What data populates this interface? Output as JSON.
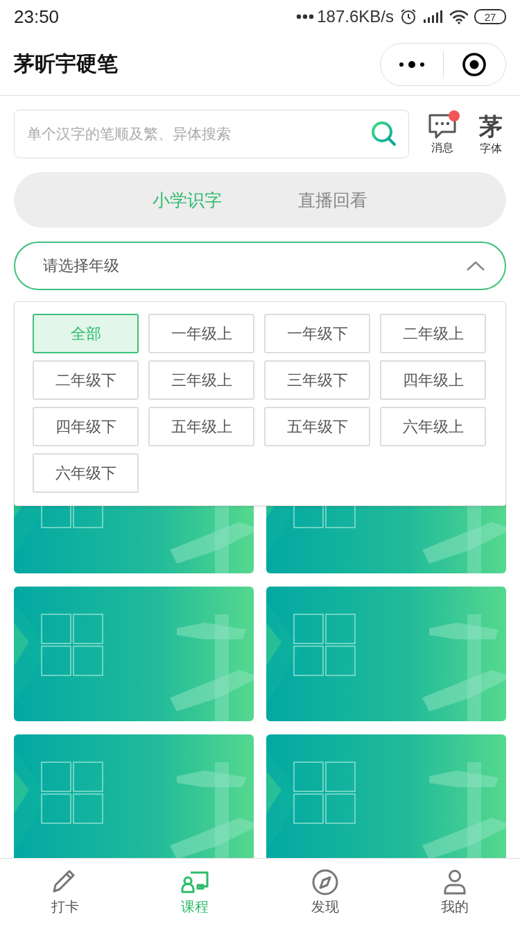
{
  "status_bar": {
    "time": "23:50",
    "network_speed": "187.6KB/s",
    "battery": "27"
  },
  "nav_bar": {
    "title": "茅昕宇硬笔"
  },
  "search": {
    "placeholder": "单个汉字的笔顺及繁、异体搜索"
  },
  "header_actions": [
    {
      "kind": "message",
      "label": "消息",
      "badge": true
    },
    {
      "kind": "font",
      "label": "字体",
      "glyph": "茅"
    }
  ],
  "tabs": [
    {
      "label": "小学识字",
      "selected": true
    },
    {
      "label": "直播回看",
      "selected": false
    }
  ],
  "grade_select": {
    "placeholder": "请选择年级",
    "expanded": true
  },
  "grade_options": [
    {
      "label": "全部",
      "selected": true
    },
    {
      "label": "一年级上",
      "selected": false
    },
    {
      "label": "一年级下",
      "selected": false
    },
    {
      "label": "二年级上",
      "selected": false
    },
    {
      "label": "二年级下",
      "selected": false
    },
    {
      "label": "三年级上",
      "selected": false
    },
    {
      "label": "三年级下",
      "selected": false
    },
    {
      "label": "四年级上",
      "selected": false
    },
    {
      "label": "四年级下",
      "selected": false
    },
    {
      "label": "五年级上",
      "selected": false
    },
    {
      "label": "五年级下",
      "selected": false
    },
    {
      "label": "六年级上",
      "selected": false
    },
    {
      "label": "六年级下",
      "selected": false
    }
  ],
  "bottom_tabs": [
    {
      "kind": "pen",
      "label": "打卡",
      "selected": false
    },
    {
      "kind": "course",
      "label": "课程",
      "selected": true
    },
    {
      "kind": "compass",
      "label": "发现",
      "selected": false
    },
    {
      "kind": "person",
      "label": "我的",
      "selected": false
    }
  ]
}
